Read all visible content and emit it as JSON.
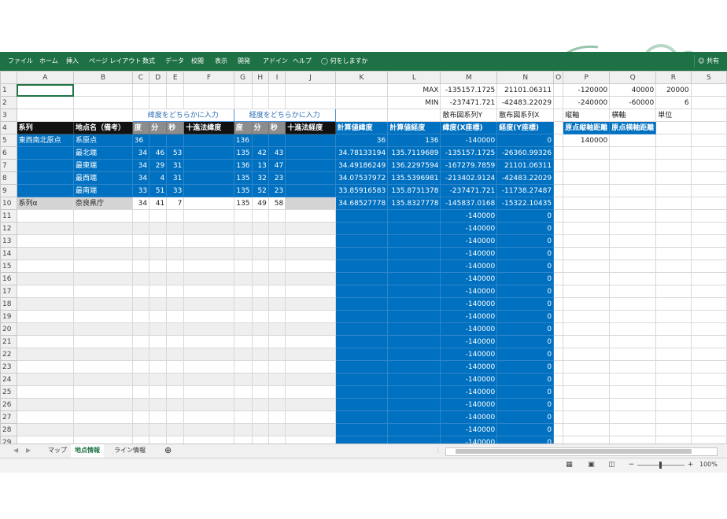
{
  "ribbon": {
    "menus": [
      "ファイル",
      "ホーム",
      "挿入",
      "ページ レイアウト",
      "数式",
      "データ",
      "校閲",
      "表示",
      "開発",
      "アドイン",
      "ヘルプ"
    ],
    "tell_me": "何をしますか",
    "share": "共有"
  },
  "columns": [
    "A",
    "B",
    "C",
    "D",
    "E",
    "F",
    "G",
    "H",
    "I",
    "J",
    "K",
    "L",
    "M",
    "N",
    "O",
    "P",
    "Q",
    "R",
    "S"
  ],
  "row_numbers": [
    "1",
    "2",
    "3",
    "4",
    "5",
    "6",
    "7",
    "8",
    "9",
    "10",
    "11",
    "12",
    "13",
    "14",
    "15",
    "16",
    "17",
    "18",
    "19",
    "20",
    "21",
    "22",
    "23",
    "24",
    "25",
    "26",
    "27",
    "28",
    "29"
  ],
  "top": {
    "max_label": "MAX",
    "max_m": "-135157.1725",
    "max_n": "21101.06311",
    "max_p": "-120000",
    "max_q": "40000",
    "max_r": "20000",
    "min_label": "MIN",
    "min_m": "-237471.721",
    "min_n": "-42483.22029",
    "min_p": "-240000",
    "min_q": "-60000",
    "min_r": "6",
    "lat_hint": "緯度をどちらかに入力",
    "lon_hint": "経度をどちらかに入力",
    "scatter_y": "散布図系列Y",
    "scatter_x": "散布図系列X",
    "axis_v": "縦軸",
    "axis_h": "横軸",
    "unit": "単位"
  },
  "headers": {
    "series": "系列",
    "place": "地点名（備考）",
    "deg": "度",
    "min": "分",
    "sec": "秒",
    "dec_lat": "十進法緯度",
    "deg2": "度",
    "min2": "分",
    "sec2": "秒",
    "dec_lon": "十進法経度",
    "calc_lat": "計算値緯度",
    "calc_lon": "計算値経度",
    "lat_x": "緯度(X座標)",
    "lon_y": "経度(Y座標)",
    "origin_v": "原点縦軸距離",
    "origin_h": "原点横軸距離"
  },
  "rows": [
    {
      "a": "東西南北原点",
      "b": "系原点",
      "c": "36",
      "d": "",
      "e": "",
      "g": "136",
      "h": "",
      "i": "",
      "k": "36",
      "l": "136",
      "m": "-140000",
      "n": "0",
      "p": "140000"
    },
    {
      "a": "",
      "b": "最北端",
      "c": "34",
      "d": "46",
      "e": "53",
      "g": "135",
      "h": "42",
      "i": "43",
      "k": "34.78133194",
      "l": "135.7119689",
      "m": "-135157.1725",
      "n": "-26360.99326",
      "p": ""
    },
    {
      "a": "",
      "b": "最東端",
      "c": "34",
      "d": "29",
      "e": "31",
      "g": "136",
      "h": "13",
      "i": "47",
      "k": "34.49186249",
      "l": "136.2297594",
      "m": "-167279.7859",
      "n": "21101.06311",
      "p": ""
    },
    {
      "a": "",
      "b": "最西端",
      "c": "34",
      "d": "4",
      "e": "31",
      "g": "135",
      "h": "32",
      "i": "23",
      "k": "34.07537972",
      "l": "135.5396981",
      "m": "-213402.9124",
      "n": "-42483.22029",
      "p": ""
    },
    {
      "a": "",
      "b": "最南端",
      "c": "33",
      "d": "51",
      "e": "33",
      "g": "135",
      "h": "52",
      "i": "23",
      "k": "33.85916583",
      "l": "135.8731378",
      "m": "-237471.721",
      "n": "-11738.27487",
      "p": ""
    },
    {
      "a": "系列α",
      "b": "奈良県庁",
      "c": "34",
      "d": "41",
      "e": "7",
      "g": "135",
      "h": "49",
      "i": "58",
      "k": "34.68527778",
      "l": "135.8327778",
      "m": "-145837.0168",
      "n": "-15322.10435",
      "p": ""
    }
  ],
  "empty_m": "-140000",
  "empty_n": "0",
  "sheets": [
    "マップ",
    "地点情報",
    "ライン情報"
  ],
  "zoom": "100%"
}
